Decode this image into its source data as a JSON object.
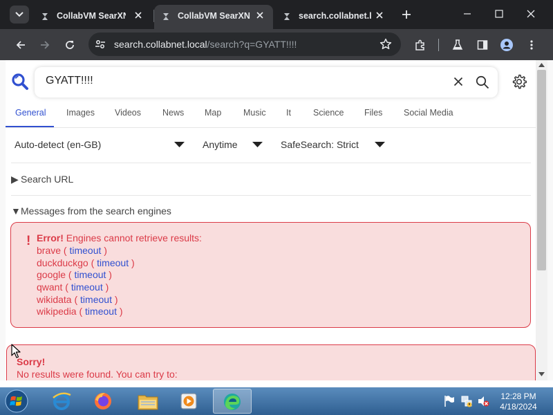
{
  "browser": {
    "tabs": [
      {
        "title": "CollabVM SearXNG",
        "active": false
      },
      {
        "title": "CollabVM SearXNG",
        "active": true
      },
      {
        "title": "search.collabnet.local",
        "active": false
      }
    ],
    "url_host": "search.collabnet.local",
    "url_path": "/search?q=GYATT!!!!"
  },
  "search": {
    "query": "GYATT!!!!",
    "categories": [
      "General",
      "Images",
      "Videos",
      "News",
      "Map",
      "Music",
      "It",
      "Science",
      "Files",
      "Social Media"
    ],
    "active_category": "General"
  },
  "filters": {
    "language": "Auto-detect (en-GB)",
    "time_range": "Anytime",
    "safesearch": "SafeSearch: Strict"
  },
  "sections": {
    "search_url": "Search URL",
    "messages": "Messages from the search engines"
  },
  "error": {
    "label": "Error!",
    "message": "Engines cannot retrieve results:",
    "engines": [
      {
        "name": "brave",
        "reason": "timeout"
      },
      {
        "name": "duckduckgo",
        "reason": "timeout"
      },
      {
        "name": "google",
        "reason": "timeout"
      },
      {
        "name": "qwant",
        "reason": "timeout"
      },
      {
        "name": "wikidata",
        "reason": "timeout"
      },
      {
        "name": "wikipedia",
        "reason": "timeout"
      }
    ]
  },
  "sorry": {
    "title": "Sorry!",
    "text": "No results were found. You can try to:"
  },
  "taskbar": {
    "time": "12:28 PM",
    "date": "4/18/2024"
  },
  "colors": {
    "accent": "#3050d0",
    "error": "#db3a47",
    "error_bg": "#f9dddd"
  }
}
